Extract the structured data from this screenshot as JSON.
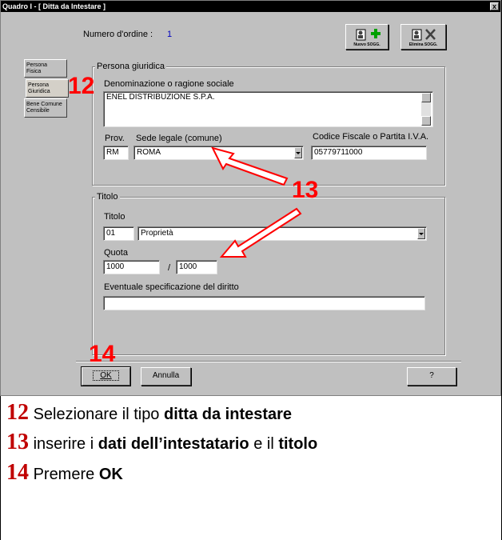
{
  "window": {
    "title": "Quadro I - [ Ditta da Intestare ]",
    "close": "x"
  },
  "header": {
    "order_label": "Numero d'ordine :",
    "order_value": "1",
    "new_btn": "Nuovo SOGG.",
    "delete_btn": "Elimina SOGG."
  },
  "tabs": [
    {
      "label1": "Persona",
      "label2": "Fisica"
    },
    {
      "label1": "Persona",
      "label2": "Giuridica"
    },
    {
      "label1": "Bene Comune",
      "label2": "Censibile"
    }
  ],
  "persona": {
    "group_title": "Persona giuridica",
    "denom_label": "Denominazione o ragione sociale",
    "denom_value": "ENEL DISTRIBUZIONE S.P.A.",
    "prov_label": "Prov.",
    "prov_value": "RM",
    "sede_label": "Sede legale (comune)",
    "sede_value": "ROMA",
    "cf_label": "Codice Fiscale o Partita I.V.A.",
    "cf_value": "05779711000"
  },
  "titolo": {
    "group_title": "Titolo",
    "titolo_label": "Titolo",
    "code_value": "01",
    "desc_value": "Proprietà",
    "quota_label": "Quota",
    "quota_num": "1000",
    "quota_sep": "/",
    "quota_den": "1000",
    "spec_label": "Eventuale specificazione del diritto",
    "spec_value": ""
  },
  "buttons": {
    "ok": "OK",
    "cancel": "Annulla",
    "help": "?"
  },
  "annotations": {
    "a12": "12",
    "a13": "13",
    "a14": "14",
    "color": "#ff0000"
  },
  "instructions": [
    {
      "num": "12",
      "pre": "Selezionare il tipo ",
      "bold": "ditta da intestare",
      "mid": "",
      "bold2": ""
    },
    {
      "num": "13",
      "pre": "inserire i ",
      "bold": "dati dell’intestatario",
      "mid": " e il ",
      "bold2": "titolo"
    },
    {
      "num": "14",
      "pre": "Premere ",
      "bold": "OK",
      "mid": "",
      "bold2": ""
    }
  ]
}
